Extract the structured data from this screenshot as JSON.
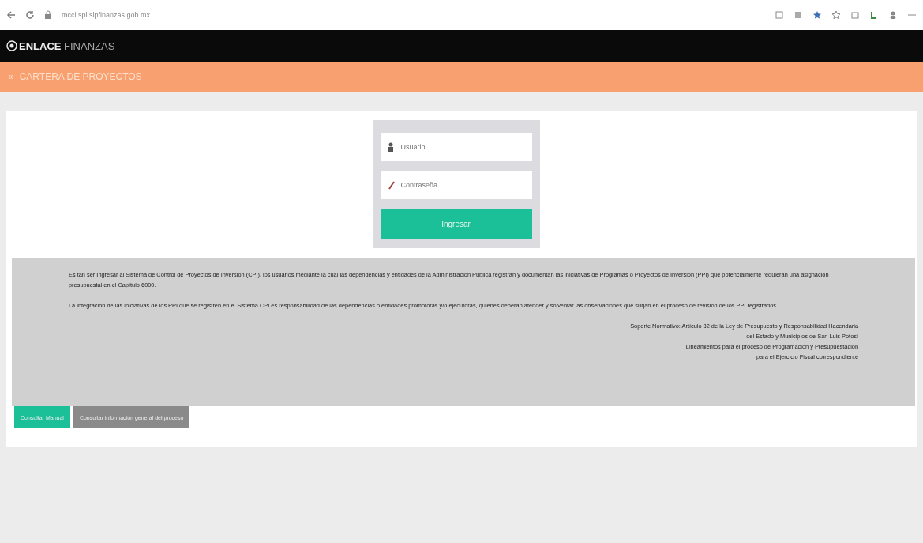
{
  "browser": {
    "url": "mcci.spl.slpfinanzas.gob.mx"
  },
  "header": {
    "brand": "**ENLACE** FINANZAS"
  },
  "section_bar": {
    "icon": "«",
    "title": "CARTERA DE PROYECTOS"
  },
  "login": {
    "username": {
      "placeholder": "Usuario"
    },
    "password": {
      "placeholder": "Contraseña"
    },
    "submit": "Ingresar"
  },
  "info": {
    "paragraphs": [
      "Es tan ser Ingresar al Sistema de Control de Proyectos de Inversión (CPI), los usuarios mediante la cual las dependencias y entidades de la Administración Pública registran y documentan las iniciativas de Programas o Proyectos de Inversión (PPI) que potencialmente requieran una asignación presupuestal en el Capítulo 6000.",
      "La integración de las iniciativas de los PPI que se registren en el Sistema CPI es responsabilidad de las dependencias o entidades promotoras y/o ejecutoras, quienes deberán atender y solventar las observaciones que surjan en el proceso de revisión de los PPI registrados."
    ],
    "legal": [
      "Soporte Normativo: Artículo 32 de la Ley de Presupuesto y Responsabilidad Hacendaria",
      "del Estado y Municipios de San Luis Potosí",
      "Lineamientos para el proceso de Programación y Presupuestación",
      "para el Ejercicio Fiscal correspondiente"
    ]
  },
  "buttons": [
    {
      "label": "Consultar Manual",
      "kind": "primary"
    },
    {
      "label": "Consultar información general del proceso",
      "kind": "secondary"
    }
  ]
}
